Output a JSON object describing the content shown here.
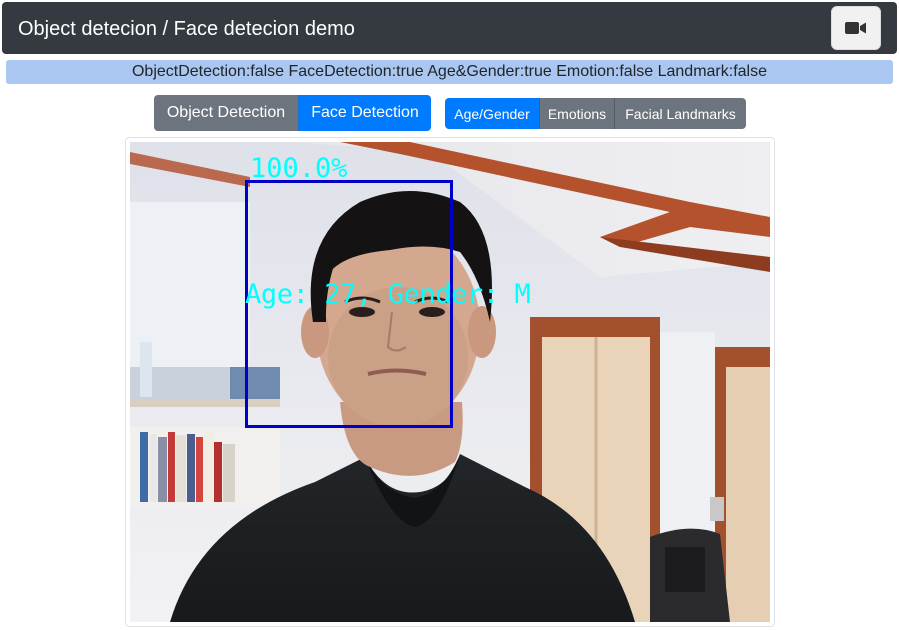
{
  "navbar": {
    "title": "Object detecion / Face detecion demo",
    "camera_icon": "video-camera-icon"
  },
  "status": {
    "text": "ObjectDetection:false FaceDetection:true Age&Gender:true Emotion:false Landmark:false"
  },
  "detection_modes": {
    "object_label": "Object Detection",
    "face_label": "Face Detection",
    "active": "Face Detection"
  },
  "face_features": {
    "age_gender_label": "Age/Gender",
    "emotions_label": "Emotions",
    "landmarks_label": "Facial Landmarks",
    "active": "Age/Gender"
  },
  "video": {
    "confidence_text": "100.0%",
    "attributes_text": "Age: 27, Gender: M"
  },
  "colors": {
    "navbar_bg": "#343a40",
    "status_bg": "#a9c7f0",
    "primary": "#007bff",
    "secondary": "#6c757d",
    "overlay_text": "#00ffff",
    "face_box": "#0000c8"
  }
}
